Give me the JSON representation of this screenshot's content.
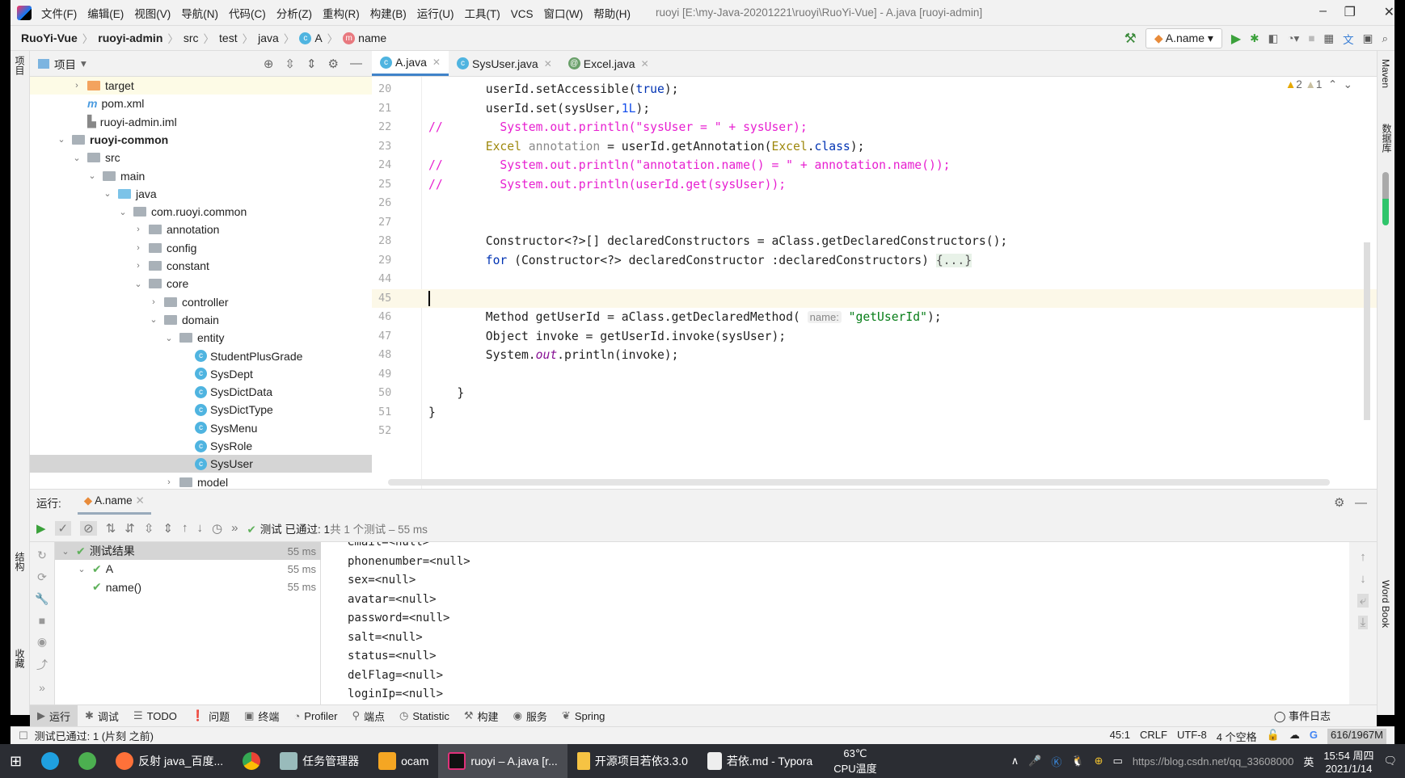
{
  "window": {
    "title": "ruoyi [E:\\my-Java-20201221\\ruoyi\\RuoYi-Vue] - A.java [ruoyi-admin]",
    "menu": [
      "文件(F)",
      "编辑(E)",
      "视图(V)",
      "导航(N)",
      "代码(C)",
      "分析(Z)",
      "重构(R)",
      "构建(B)",
      "运行(U)",
      "工具(T)",
      "VCS",
      "窗口(W)",
      "帮助(H)"
    ]
  },
  "breadcrumb": [
    "RuoYi-Vue",
    "ruoyi-admin",
    "src",
    "test",
    "java",
    "A",
    "name"
  ],
  "run_config": "A.name",
  "project": {
    "header": "项目",
    "stripe_label": "项目",
    "tree": [
      {
        "label": "target",
        "depth": 2,
        "chev": ">",
        "icon": "folder-orange",
        "hl": true
      },
      {
        "label": "pom.xml",
        "depth": 2,
        "chev": "",
        "icon": "maven"
      },
      {
        "label": "ruoyi-admin.iml",
        "depth": 2,
        "chev": "",
        "icon": "iml"
      },
      {
        "label": "ruoyi-common",
        "depth": 1,
        "chev": "v",
        "icon": "module",
        "bold": true
      },
      {
        "label": "src",
        "depth": 2,
        "chev": "v",
        "icon": "folder"
      },
      {
        "label": "main",
        "depth": 3,
        "chev": "v",
        "icon": "folder"
      },
      {
        "label": "java",
        "depth": 4,
        "chev": "v",
        "icon": "folder-blue"
      },
      {
        "label": "com.ruoyi.common",
        "depth": 5,
        "chev": "v",
        "icon": "package"
      },
      {
        "label": "annotation",
        "depth": 6,
        "chev": ">",
        "icon": "package"
      },
      {
        "label": "config",
        "depth": 6,
        "chev": ">",
        "icon": "package"
      },
      {
        "label": "constant",
        "depth": 6,
        "chev": ">",
        "icon": "package"
      },
      {
        "label": "core",
        "depth": 6,
        "chev": "v",
        "icon": "package"
      },
      {
        "label": "controller",
        "depth": 7,
        "chev": ">",
        "icon": "package"
      },
      {
        "label": "domain",
        "depth": 7,
        "chev": "v",
        "icon": "package"
      },
      {
        "label": "entity",
        "depth": 8,
        "chev": "v",
        "icon": "package"
      },
      {
        "label": "StudentPlusGrade",
        "depth": 9,
        "chev": "",
        "icon": "class"
      },
      {
        "label": "SysDept",
        "depth": 9,
        "chev": "",
        "icon": "class"
      },
      {
        "label": "SysDictData",
        "depth": 9,
        "chev": "",
        "icon": "class"
      },
      {
        "label": "SysDictType",
        "depth": 9,
        "chev": "",
        "icon": "class"
      },
      {
        "label": "SysMenu",
        "depth": 9,
        "chev": "",
        "icon": "class"
      },
      {
        "label": "SysRole",
        "depth": 9,
        "chev": "",
        "icon": "class"
      },
      {
        "label": "SysUser",
        "depth": 9,
        "chev": "",
        "icon": "class",
        "sel": true
      },
      {
        "label": "model",
        "depth": 8,
        "chev": ">",
        "icon": "package"
      }
    ]
  },
  "editor": {
    "tabs": [
      {
        "label": "A.java",
        "active": true
      },
      {
        "label": "SysUser.java"
      },
      {
        "label": "Excel.java"
      }
    ],
    "inspections": {
      "warnings": "2",
      "weak_warnings": "1"
    },
    "lines": [
      {
        "n": "20",
        "t": [
          [
            "        userId.setAccessible(",
            ""
          ],
          [
            "true",
            "kw"
          ],
          [
            ");",
            ""
          ]
        ]
      },
      {
        "n": "21",
        "t": [
          [
            "        userId.set(sysUser,",
            ""
          ],
          [
            "1L",
            "num"
          ],
          [
            ");",
            ""
          ]
        ]
      },
      {
        "n": "22",
        "t": [
          [
            "//        System.out.println(\"sysUser = \" + sysUser);",
            "cm"
          ]
        ]
      },
      {
        "n": "23",
        "t": [
          [
            "        ",
            ""
          ],
          [
            "Excel",
            "ty"
          ],
          [
            " annotation",
            "gr"
          ],
          [
            " = userId.getAnnotation(",
            ""
          ],
          [
            "Excel",
            "ty"
          ],
          [
            ".",
            ""
          ],
          [
            "class",
            "kw"
          ],
          [
            ");",
            ""
          ]
        ]
      },
      {
        "n": "24",
        "t": [
          [
            "//        System.out.println(\"annotation.name() = \" + annotation.name());",
            "cm"
          ]
        ]
      },
      {
        "n": "25",
        "t": [
          [
            "//        System.out.println(userId.get(sysUser));",
            "cm"
          ]
        ]
      },
      {
        "n": "26",
        "t": []
      },
      {
        "n": "27",
        "t": []
      },
      {
        "n": "28",
        "t": [
          [
            "        Constructor<?>[] declaredConstructors = aClass.getDeclaredConstructors();",
            ""
          ]
        ]
      },
      {
        "n": "29",
        "t": [
          [
            "        ",
            ""
          ],
          [
            "for",
            "kw"
          ],
          [
            " (Constructor<?> declaredConstructor :declaredConstructors) ",
            ""
          ],
          [
            "{...}",
            "fold"
          ]
        ]
      },
      {
        "n": "44",
        "t": []
      },
      {
        "n": "45",
        "t": [],
        "cur": true
      },
      {
        "n": "46",
        "t": [
          [
            "        Method getUserId = aClass.getDeclaredMethod( ",
            ""
          ],
          [
            "name:",
            "hint"
          ],
          [
            " ",
            ""
          ],
          [
            "\"getUserId\"",
            "str"
          ],
          [
            ");",
            ""
          ]
        ]
      },
      {
        "n": "47",
        "t": [
          [
            "        Object invoke = getUserId.invoke(sysUser);",
            ""
          ]
        ]
      },
      {
        "n": "48",
        "t": [
          [
            "        System.",
            ""
          ],
          [
            "out",
            "it"
          ],
          [
            ".println(invoke);",
            ""
          ]
        ]
      },
      {
        "n": "49",
        "t": []
      },
      {
        "n": "50",
        "t": [
          [
            "    }",
            ""
          ]
        ]
      },
      {
        "n": "51",
        "t": [
          [
            "}",
            ""
          ]
        ]
      },
      {
        "n": "52",
        "t": []
      }
    ]
  },
  "run": {
    "label": "运行:",
    "tab": "A.name",
    "status_prefix": "测试 已通过:",
    "status_count": "1",
    "status_rest": "共 1 个测试 – 55 ms",
    "tree": [
      {
        "label": "测试结果",
        "time": "55 ms",
        "depth": 0,
        "sel": true
      },
      {
        "label": "A",
        "time": "55 ms",
        "depth": 1
      },
      {
        "label": "name()",
        "time": "55 ms",
        "depth": 2
      }
    ],
    "console": [
      "email=<null>",
      "phonenumber=<null>",
      "sex=<null>",
      "avatar=<null>",
      "password=<null>",
      "salt=<null>",
      "status=<null>",
      "delFlag=<null>",
      "loginIp=<null>"
    ]
  },
  "left_stripe": {
    "structure": "结构",
    "favorites": "收藏"
  },
  "right_stripe": {
    "maven": "Maven",
    "database": "数据库",
    "wordbook": "Word Book"
  },
  "tool_tabs": [
    "运行",
    "调试",
    "TODO",
    "问题",
    "终端",
    "Profiler",
    "端点",
    "Statistic",
    "构建",
    "服务",
    "Spring"
  ],
  "event_log": "事件日志",
  "status": {
    "message": "测试已通过: 1 (片刻 之前)",
    "position": "45:1",
    "line_sep": "CRLF",
    "encoding": "UTF-8",
    "indent": "4 个空格",
    "memory": "616/1967M"
  },
  "taskbar": {
    "items": [
      "反射 java_百度...",
      "任务管理器",
      "ocam",
      "ruoyi – A.java [r...",
      "开源项目若依3.3.0",
      "若依.md - Typora"
    ],
    "cpu_temp": "63℃",
    "cpu_label": "CPU温度",
    "ime": "英",
    "time": "15:54 周四",
    "date": "2021/1/14",
    "watermark": "https://blog.csdn.net/qq_33608000"
  }
}
